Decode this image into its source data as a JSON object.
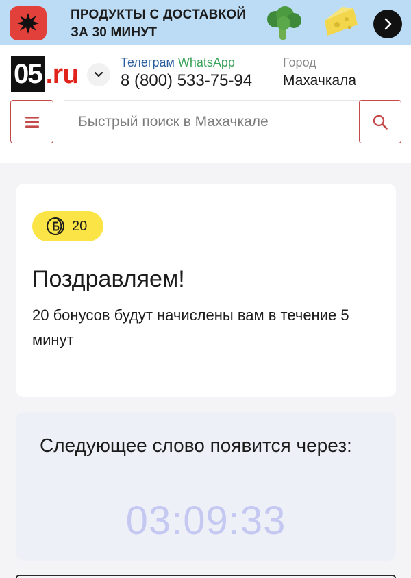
{
  "promo": {
    "line1": "Продукты с доставкой",
    "line2": "за 30 минут",
    "colors": {
      "background": "#bcdcf5",
      "logo": "#e2403a"
    },
    "icons": [
      "splash-logo-icon",
      "broccoli-icon",
      "cheese-icon",
      "chevron-right-icon"
    ]
  },
  "header": {
    "logo_dark": "05",
    "logo_red": ".ru",
    "contact_telegram": "Телеграм",
    "contact_whatsapp": "WhatsApp",
    "phone": "8 (800) 533-75-94",
    "city_label": "Город",
    "city_value": "Махачкала"
  },
  "search": {
    "placeholder": "Быстрый поиск в Махачкале"
  },
  "congrats": {
    "bonus_count": "20",
    "title": "Поздравляем!",
    "text": "20 бонусов будут начислены вам в течение 5 минут"
  },
  "timer": {
    "label": "Следующее слово появится через:",
    "value": "03:09:33"
  },
  "colors": {
    "accent_red": "#c44a4a",
    "badge_yellow": "#fbe445",
    "timer_text": "#c5c9f2",
    "timer_bg": "#eef0f8"
  }
}
